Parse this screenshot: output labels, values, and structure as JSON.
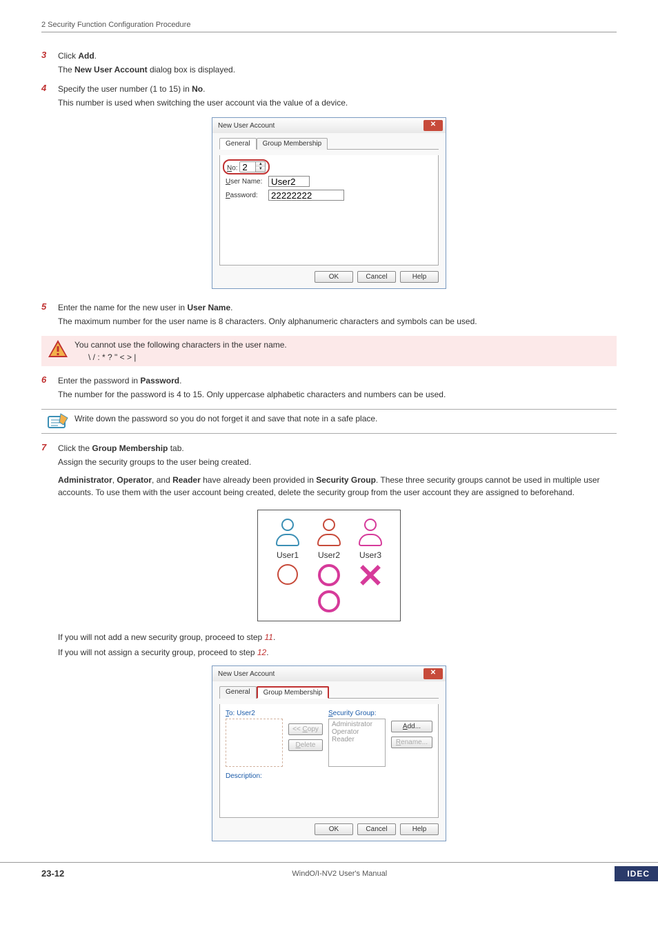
{
  "header": {
    "breadcrumb": "2 Security Function Configuration Procedure"
  },
  "steps": {
    "s3": {
      "num": "3",
      "l1a": "Click ",
      "l1b": "Add",
      "l1c": ".",
      "l2a": "The ",
      "l2b": "New User Account",
      "l2c": " dialog box is displayed."
    },
    "s4": {
      "num": "4",
      "l1a": "Specify the user number (1 to 15) in ",
      "l1b": "No",
      "l1c": ".",
      "l2": "This number is used when switching the user account via the value of a device."
    },
    "s5": {
      "num": "5",
      "l1a": "Enter the name for the new user in ",
      "l1b": "User Name",
      "l1c": ".",
      "l2": "The maximum number for the user name is 8 characters. Only alphanumeric characters and symbols can be used."
    },
    "s6": {
      "num": "6",
      "l1a": "Enter the password in ",
      "l1b": "Password",
      "l1c": ".",
      "l2": "The number for the password is 4 to 15. Only uppercase alphabetic characters and numbers can be used."
    },
    "s7": {
      "num": "7",
      "l1a": "Click the ",
      "l1b": "Group Membership",
      "l1c": " tab.",
      "l2": "Assign the security groups to the user being created.",
      "l3a": "Administrator",
      "l3b": ", ",
      "l3c": "Operator",
      "l3d": ", and ",
      "l3e": "Reader",
      "l3f": " have already been provided in ",
      "l3g": "Security Group",
      "l3h": ". These three security groups cannot be used in multiple user accounts. To use them with the user account being created, delete the security group from the user account they are assigned to beforehand.",
      "p1a": "If you will not add a new security group, proceed to step ",
      "p1b": "11",
      "p1c": ".",
      "p2a": "If you will not assign a security group, proceed to step ",
      "p2b": "12",
      "p2c": "."
    }
  },
  "warn": {
    "l1": "You cannot use the following characters in the user name.",
    "l2": "\\ / : * ? \" < > |"
  },
  "note": {
    "l1": "Write down the password so you do not forget it and save that note in a safe place."
  },
  "dialog1": {
    "title": "New User Account",
    "tabs": {
      "general": "General",
      "gm": "Group Membership"
    },
    "no_label": "No:",
    "no_u": "N",
    "no_val": "2",
    "un_label": "ser Name:",
    "un_u": "U",
    "un_val": "User2",
    "pw_label": "assword:",
    "pw_u": "P",
    "pw_val": "22222222",
    "ok": "OK",
    "cancel": "Cancel",
    "help": "Help"
  },
  "usersFig": {
    "u1": "User1",
    "u2": "User2",
    "u3": "User3"
  },
  "dialog2": {
    "title": "New User Account",
    "tabs": {
      "general": "General",
      "gm": "Group Membership"
    },
    "to_u": "T",
    "to_label": "o: User2",
    "sg_u": "S",
    "sg_label": "ecurity Group:",
    "sg_items": {
      "a": "Administrator",
      "b": "Operator",
      "c": "Reader"
    },
    "copy": "<< Copy",
    "copy_u": "C",
    "delete": "elete",
    "delete_u": "D",
    "add": "dd...",
    "add_u": "A",
    "rename": "ename...",
    "rename_u": "R",
    "desc": "Description:",
    "ok": "OK",
    "cancel": "Cancel",
    "help": "Help"
  },
  "footer": {
    "page": "23-12",
    "manual": "WindO/I-NV2 User's Manual",
    "brand": "IDEC"
  }
}
